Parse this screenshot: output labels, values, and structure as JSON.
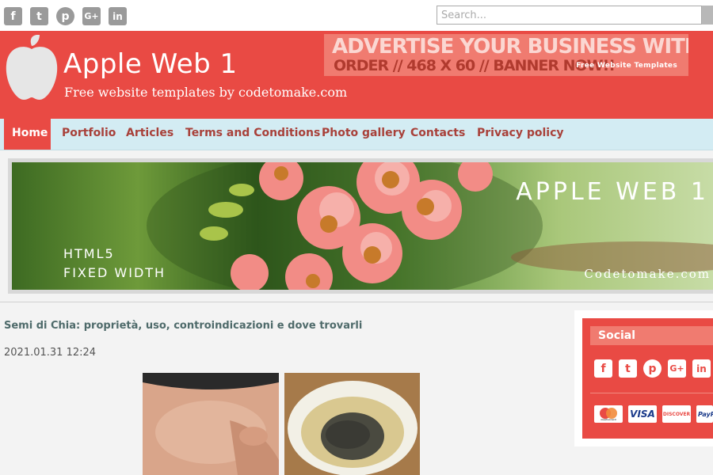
{
  "top_social": {
    "icons": [
      "facebook-icon",
      "twitter-icon",
      "pinterest-icon",
      "google-plus-icon",
      "linkedin-icon"
    ],
    "glyphs": [
      "f",
      "t",
      "p",
      "G+",
      "in"
    ]
  },
  "search": {
    "placeholder": "Search..."
  },
  "header": {
    "title": "Apple Web 1",
    "subtitle": "Free website templates by codetomake.com",
    "bg_color": "#e94a44"
  },
  "ad": {
    "line1": "ADVERTISE YOUR BUSINESS WITH US",
    "line2": "ORDER // 468 X 60 // BANNER NOW!!",
    "line3": "Free Website Templates"
  },
  "nav": {
    "items": [
      "Home",
      "Portfolio",
      "Articles",
      "Terms and Conditions",
      "Photo gallery",
      "Contacts",
      "Privacy policy"
    ],
    "active": "Home",
    "bg_color": "#d3ecf3"
  },
  "banner": {
    "title": "APPLE WEB 1",
    "line1": "HTML5",
    "line2": "FIXED WIDTH",
    "site": "Codetomake.com"
  },
  "article": {
    "title": "Semi di Chia: proprietà, uso, controindicazioni e dove trovarli",
    "date": "2021.01.31 12:24"
  },
  "sidebar": {
    "heading": "Social",
    "social_icons": [
      "facebook-icon",
      "twitter-icon",
      "pinterest-icon",
      "google-plus-icon",
      "linkedin-icon"
    ],
    "payment": [
      "mastercard",
      "VISA",
      "DISCOVER",
      "PayPal"
    ]
  }
}
